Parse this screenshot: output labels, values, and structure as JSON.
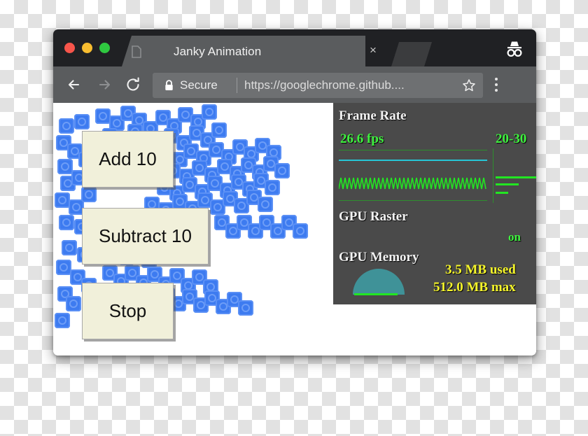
{
  "browser": {
    "window_controls": [
      "close",
      "minimize",
      "maximize"
    ],
    "tab": {
      "title": "Janky Animation",
      "close_label": "×",
      "favicon_name": "page-favicon"
    },
    "new_tab_label": "",
    "incognito_label": "Incognito",
    "toolbar": {
      "back_label": "←",
      "forward_label": "→",
      "reload_label": "⟳",
      "security_label": "Secure",
      "url": "https://googlechrome.github....",
      "bookmark_label": "☆",
      "menu_label": "⋮"
    }
  },
  "page": {
    "buttons": [
      {
        "id": "add",
        "label": "Add 10"
      },
      {
        "id": "sub",
        "label": "Subtract 10"
      },
      {
        "id": "stop",
        "label": "Stop"
      }
    ],
    "sprite_count": 118,
    "sprite_color": "#3d7bf0"
  },
  "hud": {
    "frame_rate": {
      "title": "Frame Rate",
      "current": "26.6 fps",
      "range": "20-30",
      "value_color": "#3ef23e"
    },
    "gpu_raster": {
      "title": "GPU Raster",
      "state": "on",
      "value_color": "#3ef23e"
    },
    "gpu_memory": {
      "title": "GPU Memory",
      "used": "3.5 MB used",
      "max": "512.0 MB max",
      "value_color": "#f5f52a"
    }
  }
}
